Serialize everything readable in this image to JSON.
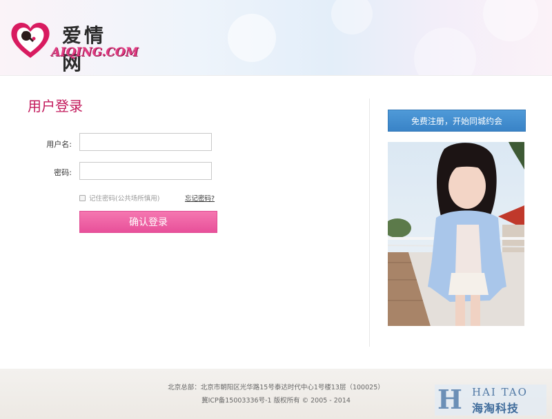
{
  "header": {
    "logo_cn": "爱情网",
    "logo_en": "AIQING.COM"
  },
  "login": {
    "title": "用户登录",
    "username_label": "用户名:",
    "username_value": "",
    "password_label": "密码:",
    "password_value": "",
    "remember_label": "记住密码(公共场所慎用)",
    "forgot_label": "忘记密码?",
    "submit_label": "确认登录"
  },
  "sidebar": {
    "register_label": "免费注册，开始同城约会"
  },
  "footer": {
    "address": "北京总部：北京市朝阳区光华路15号泰达时代中心1号楼13层（100025）",
    "copyright": "冀ICP备15003336号-1 版权所有 © 2005 - 2014"
  },
  "watermark": {
    "en": "HAI TAO",
    "cn": "海淘科技",
    "glyph": "H"
  },
  "colors": {
    "accent_pink": "#c2185b",
    "login_button": "#ee5fa3",
    "register_button": "#4289cc"
  },
  "icons": {
    "logo": "heart-icon"
  }
}
